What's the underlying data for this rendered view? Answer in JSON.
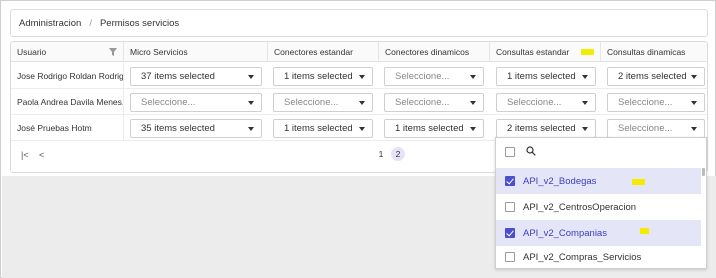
{
  "breadcrumb": {
    "root": "Administracion",
    "current": "Permisos servicios"
  },
  "columns": [
    "Usuario",
    "Micro Servicios",
    "Conectores estandar",
    "Conectores dinamicos",
    "Consultas estandar",
    "Consultas dinamicas"
  ],
  "rows": [
    {
      "user": "Jose Rodrigo Roldan Rodrig..",
      "cells": [
        "37 items selected",
        "1 items selected",
        "Seleccione...",
        "1 items selected",
        "2 items selected"
      ]
    },
    {
      "user": "Paola Andrea Davila Menes..",
      "cells": [
        "Seleccione...",
        "Seleccione...",
        "Seleccione...",
        "Seleccione...",
        "Seleccione..."
      ]
    },
    {
      "user": "José Pruebas Hotm",
      "cells": [
        "35 items selected",
        "1 items selected",
        "1 items selected",
        "2 items selected",
        "Seleccione..."
      ]
    }
  ],
  "pager": {
    "first": "|<",
    "prev": "<",
    "pages": [
      "1",
      "2"
    ],
    "current": "2"
  },
  "dropdown": {
    "items": [
      {
        "label": "API_v2_Bodegas",
        "checked": true
      },
      {
        "label": "API_v2_CentrosOperacion",
        "checked": false
      },
      {
        "label": "API_v2_Companias",
        "checked": true
      },
      {
        "label": "API_v2_Compras_Servicios",
        "checked": false
      }
    ]
  },
  "icons": {
    "filter": "filter-icon",
    "search": "search-icon",
    "caret": "chevron-down-icon"
  },
  "colors": {
    "accent": "#4a4fd0",
    "highlight": "#f4ec00",
    "selected_bg": "#e5e5f8"
  }
}
